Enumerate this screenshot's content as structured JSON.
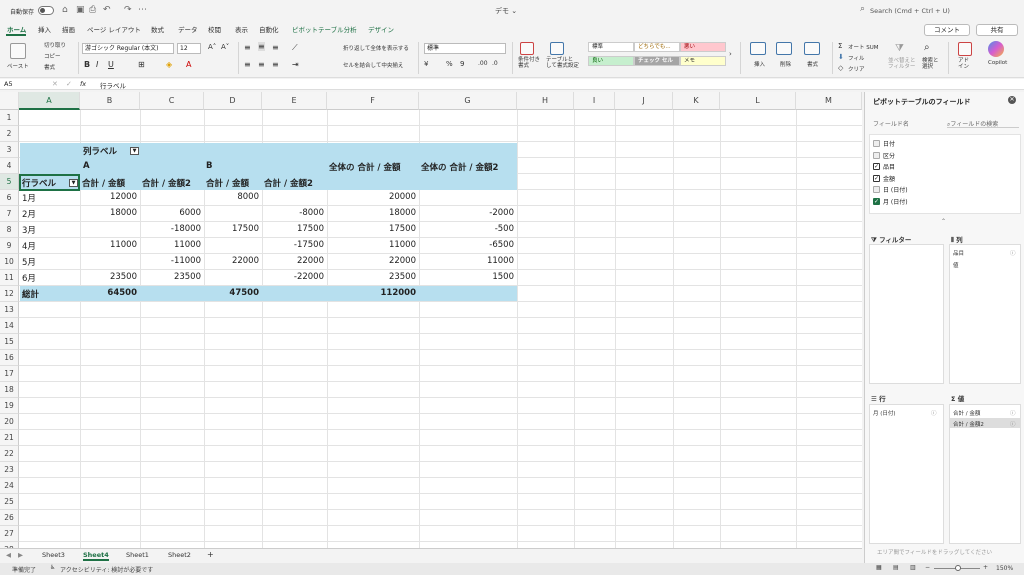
{
  "titlebar": {
    "autosave": "自動保存",
    "doc_title": "デモ ⌄",
    "search": "Search (Cmd + Ctrl + U)"
  },
  "tabs": [
    "ホーム",
    "挿入",
    "描画",
    "ページ レイアウト",
    "数式",
    "データ",
    "校閲",
    "表示",
    "自動化",
    "ピボットテーブル分析",
    "デザイン"
  ],
  "buttons": {
    "comment": "コメント",
    "share": "共有"
  },
  "ribbon": {
    "paste": "ペースト",
    "cut": "切り取り",
    "copy": "コピー",
    "format_painter": "書式",
    "font_name": "游ゴシック Regular (本文)",
    "font_size": "12",
    "wrap_text": "折り返して全体を表示する",
    "merge_center": "セルを結合して中央揃え",
    "number_format": "標準",
    "conditional": "条件付き\n書式",
    "table_format": "テーブルと\nして書式設定",
    "styles": [
      "標準",
      "どちらでも...",
      "悪い",
      "良い",
      "チェック セル",
      "メモ"
    ],
    "insert": "挿入",
    "delete": "削除",
    "format": "書式",
    "autosum": "オート SUM",
    "fill": "フィル",
    "clear": "クリア",
    "sort_filter": "並べ替えと\nフィルター",
    "find_select": "検索と\n選択",
    "addin": "アド\nイン",
    "copilot": "Copilot"
  },
  "formula": {
    "namebox": "A5",
    "fx": "fx",
    "value": "行ラベル"
  },
  "columns": [
    "A",
    "B",
    "C",
    "D",
    "E",
    "F",
    "G",
    "H",
    "I",
    "J",
    "K",
    "L",
    "M"
  ],
  "rows": [
    "1",
    "2",
    "3",
    "4",
    "5",
    "6",
    "7",
    "8",
    "9",
    "10",
    "11",
    "12",
    "13",
    "14",
    "15",
    "16",
    "17",
    "18",
    "19",
    "20",
    "21",
    "22",
    "23",
    "24",
    "25",
    "26",
    "27",
    "28",
    "29"
  ],
  "pivot": {
    "col_labels": "列ラベル",
    "group_a": "A",
    "group_b": "B",
    "row_labels": "行ラベル",
    "headers": [
      "合計 / 金額",
      "合計 / 金額2",
      "合計 / 金額",
      "合計 / 金額2",
      "全体の 合計 / 金額",
      "全体の 合計 / 金額2"
    ],
    "data_rows": [
      {
        "label": "1月",
        "values": [
          "12000",
          "",
          "8000",
          "",
          "20000",
          ""
        ]
      },
      {
        "label": "2月",
        "values": [
          "18000",
          "6000",
          "",
          "-8000",
          "18000",
          "-2000"
        ]
      },
      {
        "label": "3月",
        "values": [
          "",
          "-18000",
          "17500",
          "17500",
          "17500",
          "-500"
        ]
      },
      {
        "label": "4月",
        "values": [
          "11000",
          "11000",
          "",
          "-17500",
          "11000",
          "-6500"
        ]
      },
      {
        "label": "5月",
        "values": [
          "",
          "-11000",
          "22000",
          "22000",
          "22000",
          "11000"
        ]
      },
      {
        "label": "6月",
        "values": [
          "23500",
          "23500",
          "",
          "-22000",
          "23500",
          "1500"
        ]
      }
    ],
    "total": {
      "label": "総計",
      "values": [
        "64500",
        "",
        "47500",
        "",
        "112000",
        ""
      ]
    }
  },
  "sheets": [
    "Sheet3",
    "Sheet4",
    "Sheet1",
    "Sheet2"
  ],
  "active_sheet": "Sheet4",
  "status": {
    "ready": "準備完了",
    "accessibility": "アクセシビリティ: 検討が必要です",
    "zoom": "150%"
  },
  "panel": {
    "title": "ピボットテーブルのフィールド",
    "field_name": "フィールド名",
    "search": "フィールドの検索",
    "fields": [
      {
        "label": "日付",
        "checked": false
      },
      {
        "label": "区分",
        "checked": false
      },
      {
        "label": "品目",
        "checked": true
      },
      {
        "label": "金額",
        "checked": true
      },
      {
        "label": "日 (日付)",
        "checked": false
      },
      {
        "label": "月 (日付)",
        "checked": true
      }
    ],
    "filters": "フィルター",
    "columns": "列",
    "columns_items": [
      "品目",
      "値"
    ],
    "rows": "行",
    "rows_items": [
      "月 (日付)"
    ],
    "values": "値",
    "values_items": [
      "合計 / 金額",
      "合計 / 金額2"
    ],
    "footer": "エリア間でフィールドをドラッグしてください"
  }
}
